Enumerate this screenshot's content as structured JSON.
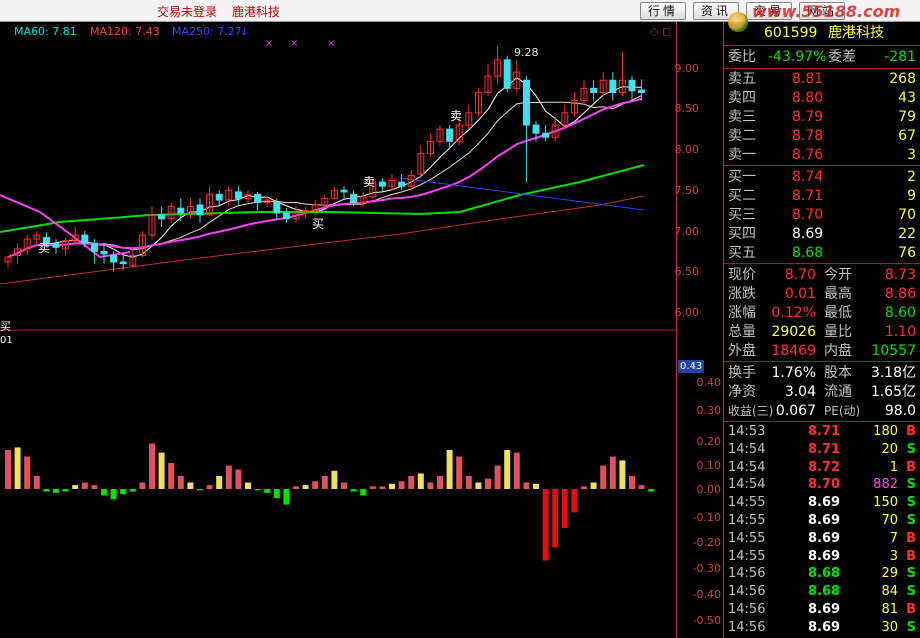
{
  "topbar": {
    "status": "交易未登录",
    "stock_name": "鹿港科技",
    "buttons": [
      "行情",
      "资讯",
      "交易",
      "网站"
    ],
    "watermark": "www.55188.com"
  },
  "indicators": [
    {
      "label": "MA60: 7.81",
      "color": "#00e0e0"
    },
    {
      "label": "MA120: 7.43",
      "color": "#ff4040"
    },
    {
      "label": "MA250: 7.27",
      "color": "#4040ff"
    }
  ],
  "chart_labels": {
    "high_label": "9.28",
    "signals": [
      "卖",
      "卖",
      "买",
      "卖"
    ],
    "left_text_1": "买",
    "left_text_2": "01"
  },
  "price_axis": [
    "9.00",
    "8.50",
    "8.00",
    "7.50",
    "7.00",
    "6.50",
    "6.00"
  ],
  "volume_axis": [
    "0.40",
    "0.30",
    "0.20",
    "0.10",
    "0.00",
    "-0.10",
    "-0.20",
    "-0.30",
    "-0.40",
    "-0.50"
  ],
  "axis_current_value": "0.43",
  "quote": {
    "code": "601599",
    "name": "鹿港科技",
    "weibi_label": "委比",
    "weibi_value": "-43.97%",
    "weicha_label": "委差",
    "weicha_value": "-281",
    "asks": [
      {
        "label": "卖五",
        "price": "8.81",
        "vol": "268"
      },
      {
        "label": "卖四",
        "price": "8.80",
        "vol": "43"
      },
      {
        "label": "卖三",
        "price": "8.79",
        "vol": "79"
      },
      {
        "label": "卖二",
        "price": "8.78",
        "vol": "67"
      },
      {
        "label": "卖一",
        "price": "8.76",
        "vol": "3"
      }
    ],
    "bids": [
      {
        "label": "买一",
        "price": "8.74",
        "vol": "2"
      },
      {
        "label": "买二",
        "price": "8.71",
        "vol": "9"
      },
      {
        "label": "买三",
        "price": "8.70",
        "vol": "70"
      },
      {
        "label": "买四",
        "price": "8.69",
        "vol": "22"
      },
      {
        "label": "买五",
        "price": "8.68",
        "vol": "76"
      }
    ],
    "stats": [
      {
        "l1": "现价",
        "v1": "8.70",
        "l2": "今开",
        "v2": "8.73"
      },
      {
        "l1": "涨跌",
        "v1": "0.01",
        "l2": "最高",
        "v2": "8.86"
      },
      {
        "l1": "涨幅",
        "v1": "0.12%",
        "l2": "最低",
        "v2": "8.60"
      },
      {
        "l1": "总量",
        "v1": "29026",
        "l2": "量比",
        "v2": "1.10"
      },
      {
        "l1": "外盘",
        "v1": "18469",
        "l2": "内盘",
        "v2": "10557"
      }
    ],
    "info": [
      {
        "l1": "换手",
        "v1": "1.76%",
        "l2": "股本",
        "v2": "3.18亿"
      },
      {
        "l1": "净资",
        "v1": "3.04",
        "l2": "流通",
        "v2": "1.65亿"
      },
      {
        "l1": "收益(三)",
        "v1": "0.067",
        "l2": "PE(动)",
        "v2": "98.0"
      }
    ],
    "ticks": [
      {
        "time": "14:53",
        "price": "8.71",
        "vol": "180",
        "side": "B"
      },
      {
        "time": "14:54",
        "price": "8.71",
        "vol": "20",
        "side": "S"
      },
      {
        "time": "14:54",
        "price": "8.72",
        "vol": "1",
        "side": "B"
      },
      {
        "time": "14:54",
        "price": "8.70",
        "vol": "882",
        "side": "S"
      },
      {
        "time": "14:55",
        "price": "8.69",
        "vol": "150",
        "side": "S"
      },
      {
        "time": "14:55",
        "price": "8.69",
        "vol": "70",
        "side": "S"
      },
      {
        "time": "14:55",
        "price": "8.69",
        "vol": "7",
        "side": "B"
      },
      {
        "time": "14:55",
        "price": "8.69",
        "vol": "3",
        "side": "B"
      },
      {
        "time": "14:56",
        "price": "8.68",
        "vol": "29",
        "side": "S"
      },
      {
        "time": "14:56",
        "price": "8.68",
        "vol": "84",
        "side": "S"
      },
      {
        "time": "14:56",
        "price": "8.69",
        "vol": "81",
        "side": "B"
      },
      {
        "time": "14:56",
        "price": "8.69",
        "vol": "30",
        "side": "S"
      }
    ]
  },
  "colors": {
    "up": "#ff3030",
    "down": "#00e000",
    "white": "#ffffff",
    "yellow": "#ffff40",
    "ma_fast": "#ffffff",
    "ma_mid": "#ff40ff",
    "ma_slow": "#00e000",
    "ma_long": "#c03030",
    "ma_blue": "#3040ff",
    "macd_red": "#ff3030",
    "macd_pink": "#e05060",
    "macd_yellow": "#f0e060"
  },
  "chart_data": {
    "type": "candlestick",
    "ylim": [
      5.9,
      9.3
    ],
    "candles": [
      [
        6.62,
        6.68,
        6.55,
        6.7
      ],
      [
        6.7,
        6.78,
        6.6,
        6.85
      ],
      [
        6.78,
        6.9,
        6.7,
        6.95
      ],
      [
        6.9,
        6.95,
        6.82,
        7.0
      ],
      [
        6.92,
        6.85,
        6.8,
        6.98
      ],
      [
        6.85,
        6.8,
        6.72,
        6.9
      ],
      [
        6.78,
        6.88,
        6.7,
        6.92
      ],
      [
        6.88,
        6.95,
        6.82,
        7.05
      ],
      [
        6.95,
        6.85,
        6.8,
        7.0
      ],
      [
        6.85,
        6.75,
        6.6,
        6.9
      ],
      [
        6.75,
        6.72,
        6.6,
        6.85
      ],
      [
        6.7,
        6.62,
        6.5,
        6.75
      ],
      [
        6.62,
        6.6,
        6.52,
        6.7
      ],
      [
        6.58,
        6.7,
        6.55,
        6.8
      ],
      [
        6.7,
        6.95,
        6.68,
        7.0
      ],
      [
        6.95,
        7.2,
        6.9,
        7.3
      ],
      [
        7.2,
        7.15,
        7.05,
        7.3
      ],
      [
        7.15,
        7.3,
        7.1,
        7.35
      ],
      [
        7.28,
        7.22,
        7.12,
        7.4
      ],
      [
        7.22,
        7.3,
        7.15,
        7.4
      ],
      [
        7.32,
        7.2,
        7.1,
        7.4
      ],
      [
        7.2,
        7.45,
        7.18,
        7.55
      ],
      [
        7.45,
        7.38,
        7.3,
        7.5
      ],
      [
        7.38,
        7.5,
        7.3,
        7.55
      ],
      [
        7.48,
        7.4,
        7.32,
        7.55
      ],
      [
        7.4,
        7.45,
        7.35,
        7.5
      ],
      [
        7.45,
        7.35,
        7.25,
        7.48
      ],
      [
        7.35,
        7.38,
        7.3,
        7.42
      ],
      [
        7.35,
        7.22,
        7.15,
        7.4
      ],
      [
        7.22,
        7.15,
        7.1,
        7.28
      ],
      [
        7.15,
        7.22,
        7.1,
        7.3
      ],
      [
        7.22,
        7.25,
        7.15,
        7.3
      ],
      [
        7.25,
        7.32,
        7.2,
        7.38
      ],
      [
        7.32,
        7.4,
        7.3,
        7.45
      ],
      [
        7.4,
        7.5,
        7.38,
        7.55
      ],
      [
        7.5,
        7.48,
        7.4,
        7.55
      ],
      [
        7.45,
        7.35,
        7.3,
        7.5
      ],
      [
        7.35,
        7.42,
        7.3,
        7.48
      ],
      [
        7.42,
        7.6,
        7.4,
        7.62
      ],
      [
        7.6,
        7.55,
        7.48,
        7.65
      ],
      [
        7.55,
        7.62,
        7.5,
        7.7
      ],
      [
        7.6,
        7.55,
        7.5,
        7.7
      ],
      [
        7.55,
        7.68,
        7.5,
        7.75
      ],
      [
        7.7,
        7.95,
        7.65,
        8.05
      ],
      [
        7.95,
        8.1,
        7.9,
        8.2
      ],
      [
        8.1,
        8.25,
        8.05,
        8.3
      ],
      [
        8.25,
        8.1,
        8.0,
        8.3
      ],
      [
        8.1,
        8.3,
        8.05,
        8.4
      ],
      [
        8.3,
        8.45,
        8.25,
        8.55
      ],
      [
        8.45,
        8.7,
        8.4,
        8.75
      ],
      [
        8.7,
        8.9,
        8.65,
        9.05
      ],
      [
        8.9,
        9.1,
        8.8,
        9.28
      ],
      [
        9.1,
        8.75,
        8.7,
        9.15
      ],
      [
        8.75,
        8.95,
        8.7,
        9.1
      ],
      [
        8.85,
        8.3,
        7.6,
        8.9
      ],
      [
        8.3,
        8.2,
        8.1,
        8.35
      ],
      [
        8.2,
        8.15,
        8.1,
        8.3
      ],
      [
        8.15,
        8.3,
        8.1,
        8.4
      ],
      [
        8.3,
        8.45,
        8.25,
        8.55
      ],
      [
        8.45,
        8.6,
        8.4,
        8.7
      ],
      [
        8.6,
        8.75,
        8.55,
        8.85
      ],
      [
        8.75,
        8.7,
        8.6,
        8.85
      ],
      [
        8.7,
        8.85,
        8.65,
        8.95
      ],
      [
        8.85,
        8.7,
        8.6,
        8.95
      ],
      [
        8.7,
        8.85,
        8.65,
        9.2
      ],
      [
        8.85,
        8.72,
        8.6,
        8.9
      ],
      [
        8.73,
        8.7,
        8.6,
        8.86
      ]
    ],
    "macd": [
      0.3,
      0.32,
      0.25,
      0.1,
      -0.02,
      -0.03,
      -0.02,
      0.03,
      0.05,
      0.03,
      -0.05,
      -0.08,
      -0.04,
      -0.02,
      0.05,
      0.35,
      0.28,
      0.2,
      0.1,
      0.05,
      -0.01,
      0.03,
      0.1,
      0.18,
      0.15,
      0.05,
      -0.01,
      -0.03,
      -0.07,
      -0.12,
      0.02,
      0.03,
      0.06,
      0.1,
      0.14,
      0.05,
      -0.02,
      -0.05,
      0.02,
      0.02,
      0.04,
      0.06,
      0.1,
      0.12,
      0.05,
      0.1,
      0.3,
      0.25,
      0.1,
      0.05,
      0.08,
      0.18,
      0.3,
      0.28,
      0.05,
      0.04,
      -0.55,
      -0.45,
      -0.3,
      -0.18,
      0.02,
      0.05,
      0.18,
      0.25,
      0.22,
      0.1,
      0.03,
      -0.02
    ]
  }
}
